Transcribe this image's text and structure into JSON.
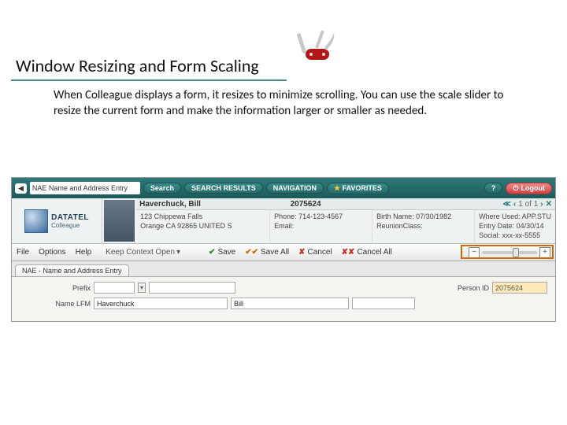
{
  "slide": {
    "title": "Window Resizing and Form Scaling",
    "body": "When Colleague displays a form, it resizes to minimize scrolling. You can use the scale slider to resize the current form and make the information larger or smaller as needed."
  },
  "app": {
    "topbar": {
      "back_caret": "◀",
      "search_text": "NAE  Name and Address Entry",
      "search_btn": "Search",
      "search_results": "SEARCH RESULTS",
      "navigation": "NAVIGATION",
      "favorites": "FAVORITES",
      "help": "?",
      "logout": "Logout"
    },
    "logo": {
      "brand": "DATATEL",
      "product": "Colleague"
    },
    "person": {
      "name": "Haverchuck, Bill",
      "id": "2075624",
      "pager": "1 of 1",
      "addr1": "123 Chippewa Falls",
      "addr2": "Orange CA 92865 UNITED S",
      "phone_lbl": "Phone:",
      "phone": "714-123-4567",
      "email_lbl": "Email:",
      "birth_lbl": "Birth Name:",
      "birth": "07/30/1982",
      "reunion_lbl": "ReunionClass:",
      "where_lbl": "Where Used:",
      "where": "APP.STU",
      "entry_lbl": "Entry Date:",
      "entry": "04/30/14",
      "social_lbl": "Social:",
      "social": "xxx-xx-5555"
    },
    "menu": {
      "file": "File",
      "options": "Options",
      "help": "Help",
      "keep": "Keep Context Open",
      "save": "Save",
      "save_all": "Save All",
      "cancel": "Cancel",
      "cancel_all": "Cancel All",
      "minus": "−",
      "plus": "+"
    },
    "tab": "NAE - Name and Address Entry",
    "form": {
      "prefix_lbl": "Prefix",
      "name_lbl": "Name LFM",
      "last": "Haverchuck",
      "first": "Bill",
      "personid_lbl": "Person ID",
      "personid": "2075624"
    }
  }
}
